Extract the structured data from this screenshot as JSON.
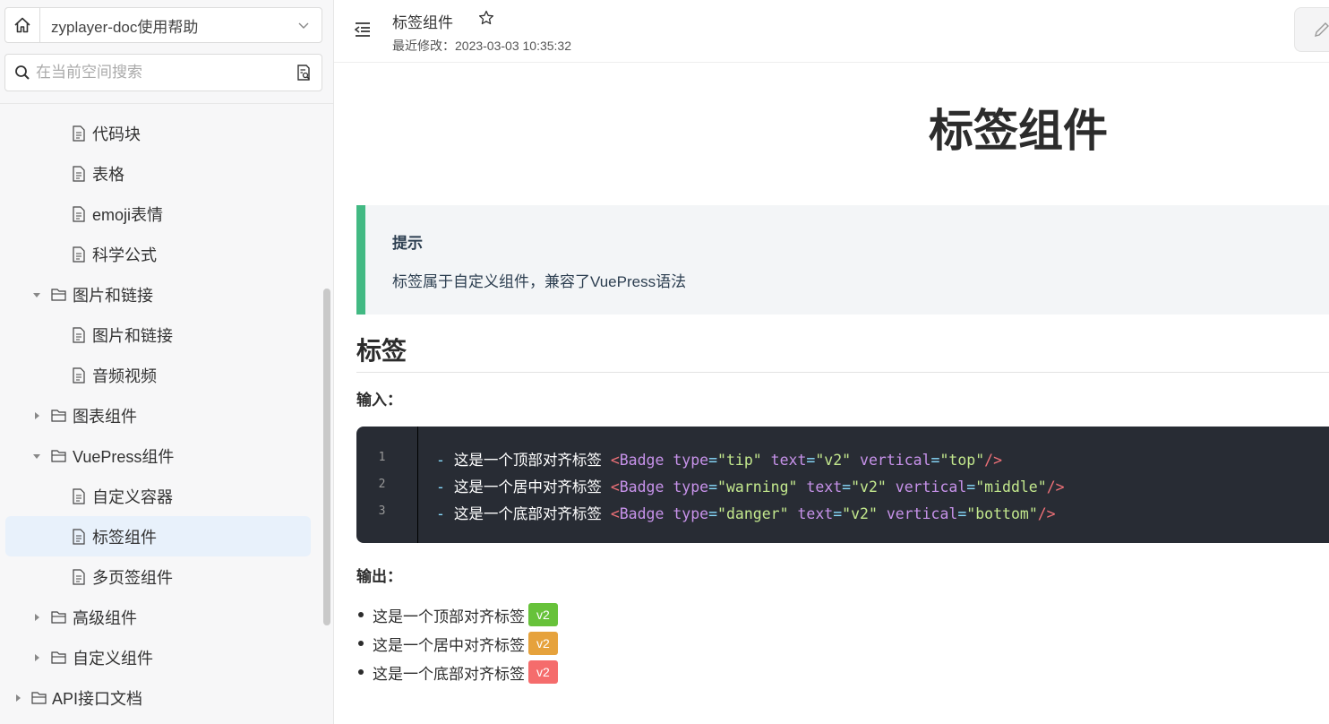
{
  "sidebar": {
    "space_name": "zyplayer-doc使用帮助",
    "search_placeholder": "在当前空间搜索",
    "tree": [
      {
        "label": "代码块",
        "type": "file",
        "level": 3
      },
      {
        "label": "表格",
        "type": "file",
        "level": 3
      },
      {
        "label": "emoji表情",
        "type": "file",
        "level": 3
      },
      {
        "label": "科学公式",
        "type": "file",
        "level": 3
      },
      {
        "label": "图片和链接",
        "type": "folder",
        "level": 2,
        "expanded": true
      },
      {
        "label": "图片和链接",
        "type": "file",
        "level": 3
      },
      {
        "label": "音频视频",
        "type": "file",
        "level": 3
      },
      {
        "label": "图表组件",
        "type": "folder",
        "level": 2,
        "expanded": false
      },
      {
        "label": "VuePress组件",
        "type": "folder",
        "level": 2,
        "expanded": true
      },
      {
        "label": "自定义容器",
        "type": "file",
        "level": 3
      },
      {
        "label": "标签组件",
        "type": "file",
        "level": 3,
        "active": true
      },
      {
        "label": "多页签组件",
        "type": "file",
        "level": 3
      },
      {
        "label": "高级组件",
        "type": "folder",
        "level": 2,
        "expanded": false
      },
      {
        "label": "自定义组件",
        "type": "folder",
        "level": 2,
        "expanded": false
      },
      {
        "label": "API接口文档",
        "type": "folder",
        "level": 1,
        "expanded": false
      }
    ]
  },
  "header": {
    "title": "标签组件",
    "last_modified": "最近修改：2023-03-03 10:35:32"
  },
  "content": {
    "h1": "标签组件",
    "tip": {
      "title": "提示",
      "text": "标签属于自定义组件，兼容了VuePress语法"
    },
    "h2": "标签",
    "input_label": "输入：",
    "code_lines": [
      {
        "num": "1",
        "text": "这是一个顶部对齐标签",
        "type": "tip",
        "vtext": "v2",
        "vertical": "top"
      },
      {
        "num": "2",
        "text": "这是一个居中对齐标签",
        "type": "warning",
        "vtext": "v2",
        "vertical": "middle"
      },
      {
        "num": "3",
        "text": "这是一个底部对齐标签",
        "type": "danger",
        "vtext": "v2",
        "vertical": "bottom"
      }
    ],
    "output_label": "输出：",
    "output_items": [
      {
        "text": "这是一个顶部对齐标签",
        "badge": "v2",
        "color": "#67c23a"
      },
      {
        "text": "这是一个居中对齐标签",
        "badge": "v2",
        "color": "#e6a23c"
      },
      {
        "text": "这是一个底部对齐标签",
        "badge": "v2",
        "color": "#f56c6c"
      }
    ]
  }
}
